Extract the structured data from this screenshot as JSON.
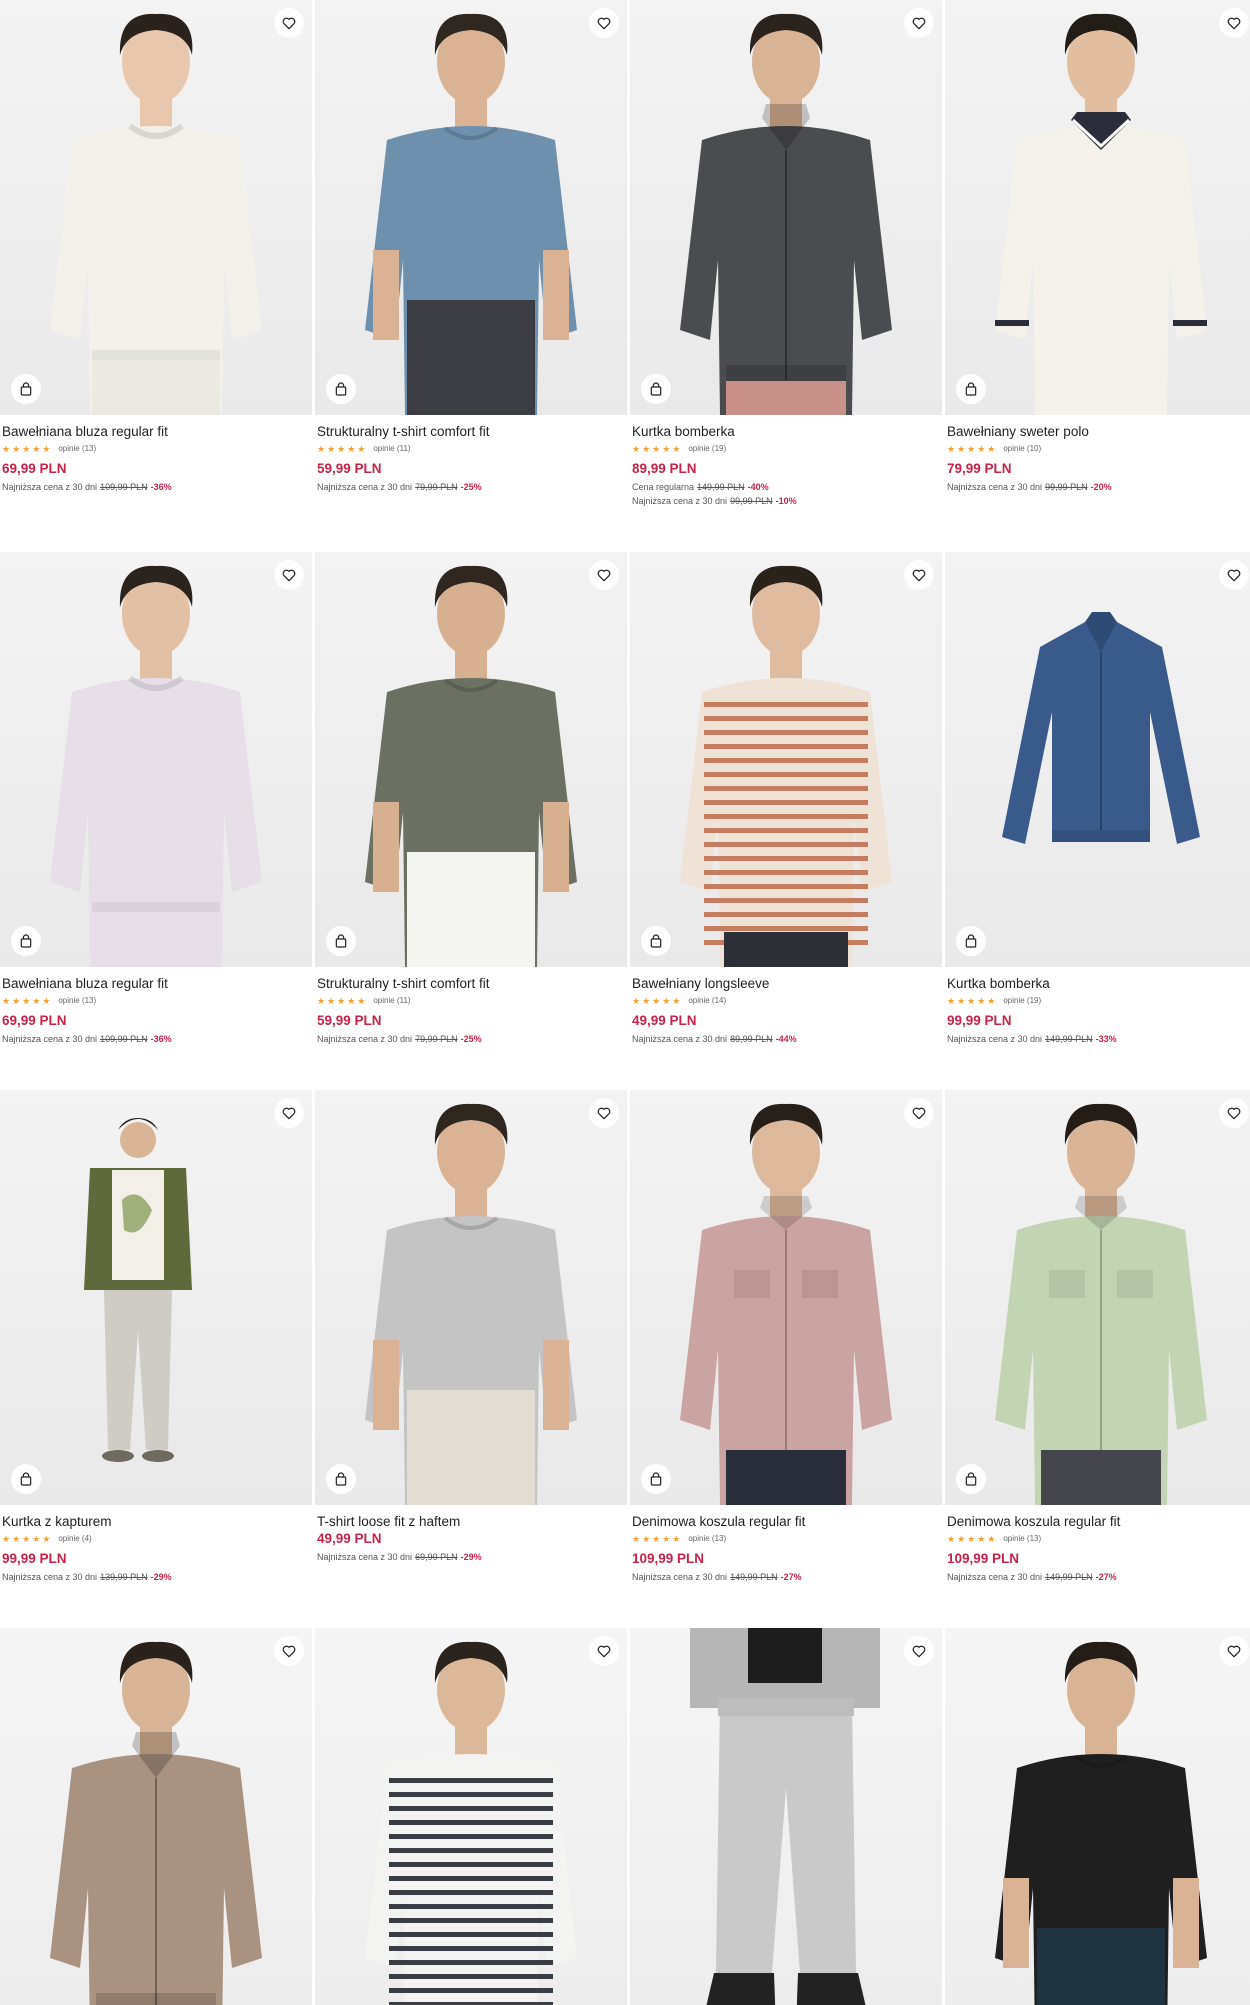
{
  "products": [
    {
      "name": "Bawełniana bluza regular fit",
      "reviews": "opinie (13)",
      "stars": "★★★★★",
      "price": "69,99 PLN",
      "price_lines": [
        {
          "label": "Najniższa cena z 30 dni",
          "old": "109,99 PLN",
          "disc": "-36%"
        }
      ]
    },
    {
      "name": "Strukturalny t-shirt comfort fit",
      "reviews": "opinie (11)",
      "stars": "★★★★★",
      "price": "59,99 PLN",
      "price_lines": [
        {
          "label": "Najniższa cena z 30 dni",
          "old": "79,99 PLN",
          "disc": "-25%"
        }
      ]
    },
    {
      "name": "Kurtka bomberka",
      "reviews": "opinie (19)",
      "stars": "★★★★★",
      "price": "89,99 PLN",
      "price_lines": [
        {
          "label": "Cena regularna",
          "old": "149,99 PLN",
          "disc": "-40%"
        },
        {
          "label": "Najniższa cena z 30 dni",
          "old": "99,99 PLN",
          "disc": "-10%"
        }
      ]
    },
    {
      "name": "Bawełniany sweter polo",
      "reviews": "opinie (10)",
      "stars": "★★★★★",
      "price": "79,99 PLN",
      "price_lines": [
        {
          "label": "Najniższa cena z 30 dni",
          "old": "99,99 PLN",
          "disc": "-20%"
        }
      ]
    },
    {
      "name": "Bawełniana bluza regular fit",
      "reviews": "opinie (13)",
      "stars": "★★★★★",
      "price": "69,99 PLN",
      "price_lines": [
        {
          "label": "Najniższa cena z 30 dni",
          "old": "109,99 PLN",
          "disc": "-36%"
        }
      ]
    },
    {
      "name": "Strukturalny t-shirt comfort fit",
      "reviews": "opinie (11)",
      "stars": "★★★★★",
      "price": "59,99 PLN",
      "price_lines": [
        {
          "label": "Najniższa cena z 30 dni",
          "old": "79,99 PLN",
          "disc": "-25%"
        }
      ]
    },
    {
      "name": "Bawełniany longsleeve",
      "reviews": "opinie (14)",
      "stars": "★★★★★",
      "price": "49,99 PLN",
      "price_lines": [
        {
          "label": "Najniższa cena z 30 dni",
          "old": "89,99 PLN",
          "disc": "-44%"
        }
      ]
    },
    {
      "name": "Kurtka bomberka",
      "reviews": "opinie (19)",
      "stars": "★★★★★",
      "price": "99,99 PLN",
      "price_lines": [
        {
          "label": "Najniższa cena z 30 dni",
          "old": "149,99 PLN",
          "disc": "-33%"
        }
      ]
    },
    {
      "name": "Kurtka z kapturem",
      "reviews": "opinie (4)",
      "stars": "★★★★★",
      "price": "99,99 PLN",
      "price_lines": [
        {
          "label": "Najniższa cena z 30 dni",
          "old": "139,99 PLN",
          "disc": "-29%"
        }
      ]
    },
    {
      "name": "T-shirt loose fit z haftem",
      "reviews": "",
      "stars": "",
      "price": "49,99 PLN",
      "price_lines": [
        {
          "label": "Najniższa cena z 30 dni",
          "old": "69,99 PLN",
          "disc": "-29%"
        }
      ]
    },
    {
      "name": "Denimowa koszula regular fit",
      "reviews": "opinie (13)",
      "stars": "★★★★★",
      "price": "109,99 PLN",
      "price_lines": [
        {
          "label": "Najniższa cena z 30 dni",
          "old": "149,99 PLN",
          "disc": "-27%"
        }
      ]
    },
    {
      "name": "Denimowa koszula regular fit",
      "reviews": "opinie (13)",
      "stars": "★★★★★",
      "price": "109,99 PLN",
      "price_lines": [
        {
          "label": "Najniższa cena z 30 dni",
          "old": "149,99 PLN",
          "disc": "-27%"
        }
      ]
    },
    {
      "name": "",
      "reviews": "",
      "stars": "",
      "price": "",
      "price_lines": []
    },
    {
      "name": "",
      "reviews": "",
      "stars": "",
      "price": "",
      "price_lines": []
    },
    {
      "name": "",
      "reviews": "",
      "stars": "",
      "price": "",
      "price_lines": []
    },
    {
      "name": "",
      "reviews": "",
      "stars": "",
      "price": "",
      "price_lines": []
    }
  ],
  "garments": [
    {
      "color": "#f2f0ea",
      "skin": "#e7c7ad",
      "hair": "#2a221c",
      "kind": "sweat",
      "pants": "#ece9e3"
    },
    {
      "color": "#6f90ad",
      "skin": "#d9b393",
      "hair": "#2f2820",
      "kind": "tee",
      "pants": "#3c3d42"
    },
    {
      "color": "#4b4c4f",
      "skin": "#d8b394",
      "hair": "#2b241e",
      "kind": "jacket",
      "pants": "#c9908a"
    },
    {
      "color": "#f4f1ea",
      "skin": "#e2bea0",
      "hair": "#231d18",
      "kind": "polo",
      "pants": "#f4f1ea"
    },
    {
      "color": "#e6dfe8",
      "skin": "#e2c0a6",
      "hair": "#2b231d",
      "kind": "sweat",
      "pants": "#e6dfe8"
    },
    {
      "color": "#6c7062",
      "skin": "#d7b090",
      "hair": "#2f2720",
      "kind": "tee",
      "pants": "#f4f4f1"
    },
    {
      "color": "#efe3d8",
      "skin": "#dfbc9f",
      "hair": "#2a231c",
      "kind": "stripe",
      "pants": "#2c2f36",
      "stripe": "#c47d60"
    },
    {
      "color": "#3b5a8c",
      "skin": "none",
      "hair": "none",
      "kind": "flatjacket",
      "pants": "none"
    },
    {
      "color": "#5e6a3c",
      "skin": "#d9b597",
      "hair": "#241d18",
      "kind": "fullbody",
      "pants": "#cfccc6"
    },
    {
      "color": "#c4c4c4",
      "skin": "#d9b393",
      "hair": "#2e2720",
      "kind": "tee",
      "pants": "#e2ddd3"
    },
    {
      "color": "#caa4a2",
      "skin": "#dcb99d",
      "hair": "#27201a",
      "kind": "shirt",
      "pants": "#2a2e3a"
    },
    {
      "color": "#c3d4b4",
      "skin": "#d9b497",
      "hair": "#231c17",
      "kind": "shirt",
      "pants": "#45464b"
    },
    {
      "color": "#a89282",
      "skin": "#d9b597",
      "hair": "#2a221c",
      "kind": "jacket",
      "pants": "#a89282"
    },
    {
      "color": "#f3f3f1",
      "skin": "#dcb89b",
      "hair": "#2b241e",
      "kind": "stripe",
      "pants": "#b9b9b9",
      "stripe": "#3a3d44"
    },
    {
      "color": "#c9c9c9",
      "skin": "none",
      "hair": "none",
      "kind": "pants",
      "pants": "#c9c9c9"
    },
    {
      "color": "#1f1f1f",
      "skin": "#d8b394",
      "hair": "#231c17",
      "kind": "tee",
      "pants": "#1f3440"
    }
  ]
}
